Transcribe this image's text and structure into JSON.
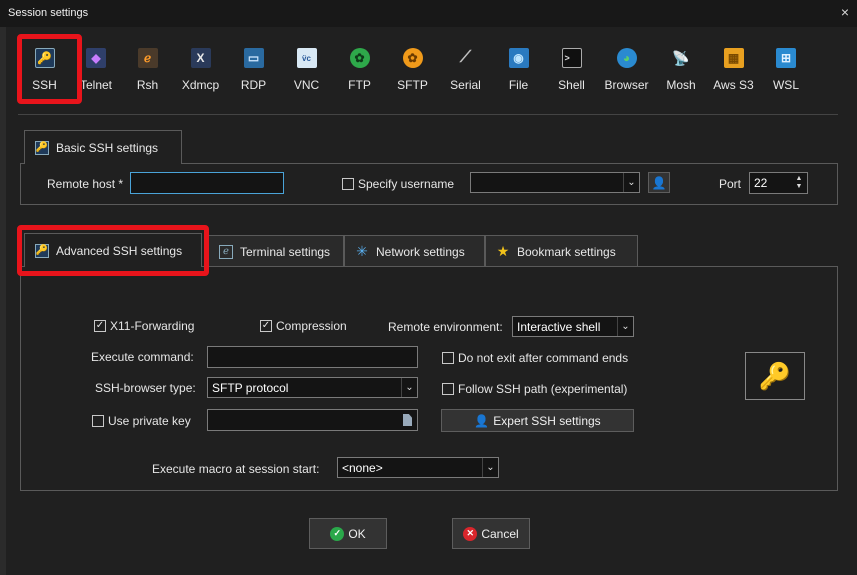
{
  "window": {
    "title": "Session settings",
    "close_glyph": "×"
  },
  "session_types": [
    {
      "label": "SSH",
      "icon": "key-icon"
    },
    {
      "label": "Telnet",
      "icon": "telnet-icon"
    },
    {
      "label": "Rsh",
      "icon": "rsh-icon"
    },
    {
      "label": "Xdmcp",
      "icon": "xdmcp-icon"
    },
    {
      "label": "RDP",
      "icon": "rdp-icon"
    },
    {
      "label": "VNC",
      "icon": "vnc-icon"
    },
    {
      "label": "FTP",
      "icon": "ftp-icon"
    },
    {
      "label": "SFTP",
      "icon": "sftp-icon"
    },
    {
      "label": "Serial",
      "icon": "serial-icon"
    },
    {
      "label": "File",
      "icon": "file-icon"
    },
    {
      "label": "Shell",
      "icon": "shell-icon"
    },
    {
      "label": "Browser",
      "icon": "globe-icon"
    },
    {
      "label": "Mosh",
      "icon": "satellite-icon"
    },
    {
      "label": "Aws S3",
      "icon": "aws-icon"
    },
    {
      "label": "WSL",
      "icon": "wsl-icon"
    }
  ],
  "basic": {
    "tab_label": "Basic SSH settings",
    "remote_host_label": "Remote host *",
    "remote_host_value": "",
    "specify_username_label": "Specify username",
    "specify_username_checked": false,
    "username_value": "",
    "port_label": "Port",
    "port_value": "22"
  },
  "tabs": [
    {
      "label": "Advanced SSH settings",
      "icon": "key-icon"
    },
    {
      "label": "Terminal settings",
      "icon": "terminal-icon"
    },
    {
      "label": "Network settings",
      "icon": "network-icon"
    },
    {
      "label": "Bookmark settings",
      "icon": "star-icon"
    }
  ],
  "advanced": {
    "x11_label": "X11-Forwarding",
    "x11_checked": true,
    "compression_label": "Compression",
    "compression_checked": true,
    "remote_env_label": "Remote environment:",
    "remote_env_value": "Interactive shell",
    "execute_command_label": "Execute command:",
    "execute_command_value": "",
    "no_exit_label": "Do not exit after command ends",
    "no_exit_checked": false,
    "browser_type_label": "SSH-browser type:",
    "browser_type_value": "SFTP protocol",
    "follow_path_label": "Follow SSH path (experimental)",
    "follow_path_checked": false,
    "private_key_label": "Use private key",
    "private_key_checked": false,
    "private_key_value": "",
    "expert_button_label": "Expert SSH settings",
    "macro_label": "Execute macro at session start:",
    "macro_value": "<none>"
  },
  "buttons": {
    "ok_label": "OK",
    "cancel_label": "Cancel"
  },
  "colors": {
    "highlight": "#e8141b",
    "focus": "#4aa3d8",
    "ok": "#2aa84a",
    "cancel": "#d9262c"
  }
}
